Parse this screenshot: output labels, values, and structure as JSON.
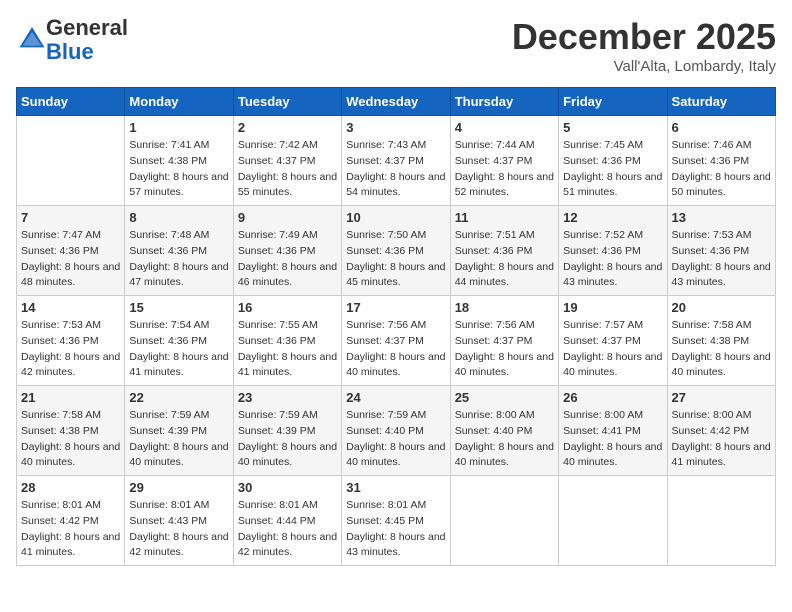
{
  "logo": {
    "general": "General",
    "blue": "Blue"
  },
  "header": {
    "month": "December 2025",
    "location": "Vall'Alta, Lombardy, Italy"
  },
  "weekdays": [
    "Sunday",
    "Monday",
    "Tuesday",
    "Wednesday",
    "Thursday",
    "Friday",
    "Saturday"
  ],
  "weeks": [
    [
      {
        "day": "",
        "sunrise": "",
        "sunset": "",
        "daylight": ""
      },
      {
        "day": "1",
        "sunrise": "Sunrise: 7:41 AM",
        "sunset": "Sunset: 4:38 PM",
        "daylight": "Daylight: 8 hours and 57 minutes."
      },
      {
        "day": "2",
        "sunrise": "Sunrise: 7:42 AM",
        "sunset": "Sunset: 4:37 PM",
        "daylight": "Daylight: 8 hours and 55 minutes."
      },
      {
        "day": "3",
        "sunrise": "Sunrise: 7:43 AM",
        "sunset": "Sunset: 4:37 PM",
        "daylight": "Daylight: 8 hours and 54 minutes."
      },
      {
        "day": "4",
        "sunrise": "Sunrise: 7:44 AM",
        "sunset": "Sunset: 4:37 PM",
        "daylight": "Daylight: 8 hours and 52 minutes."
      },
      {
        "day": "5",
        "sunrise": "Sunrise: 7:45 AM",
        "sunset": "Sunset: 4:36 PM",
        "daylight": "Daylight: 8 hours and 51 minutes."
      },
      {
        "day": "6",
        "sunrise": "Sunrise: 7:46 AM",
        "sunset": "Sunset: 4:36 PM",
        "daylight": "Daylight: 8 hours and 50 minutes."
      }
    ],
    [
      {
        "day": "7",
        "sunrise": "Sunrise: 7:47 AM",
        "sunset": "Sunset: 4:36 PM",
        "daylight": "Daylight: 8 hours and 48 minutes."
      },
      {
        "day": "8",
        "sunrise": "Sunrise: 7:48 AM",
        "sunset": "Sunset: 4:36 PM",
        "daylight": "Daylight: 8 hours and 47 minutes."
      },
      {
        "day": "9",
        "sunrise": "Sunrise: 7:49 AM",
        "sunset": "Sunset: 4:36 PM",
        "daylight": "Daylight: 8 hours and 46 minutes."
      },
      {
        "day": "10",
        "sunrise": "Sunrise: 7:50 AM",
        "sunset": "Sunset: 4:36 PM",
        "daylight": "Daylight: 8 hours and 45 minutes."
      },
      {
        "day": "11",
        "sunrise": "Sunrise: 7:51 AM",
        "sunset": "Sunset: 4:36 PM",
        "daylight": "Daylight: 8 hours and 44 minutes."
      },
      {
        "day": "12",
        "sunrise": "Sunrise: 7:52 AM",
        "sunset": "Sunset: 4:36 PM",
        "daylight": "Daylight: 8 hours and 43 minutes."
      },
      {
        "day": "13",
        "sunrise": "Sunrise: 7:53 AM",
        "sunset": "Sunset: 4:36 PM",
        "daylight": "Daylight: 8 hours and 43 minutes."
      }
    ],
    [
      {
        "day": "14",
        "sunrise": "Sunrise: 7:53 AM",
        "sunset": "Sunset: 4:36 PM",
        "daylight": "Daylight: 8 hours and 42 minutes."
      },
      {
        "day": "15",
        "sunrise": "Sunrise: 7:54 AM",
        "sunset": "Sunset: 4:36 PM",
        "daylight": "Daylight: 8 hours and 41 minutes."
      },
      {
        "day": "16",
        "sunrise": "Sunrise: 7:55 AM",
        "sunset": "Sunset: 4:36 PM",
        "daylight": "Daylight: 8 hours and 41 minutes."
      },
      {
        "day": "17",
        "sunrise": "Sunrise: 7:56 AM",
        "sunset": "Sunset: 4:37 PM",
        "daylight": "Daylight: 8 hours and 40 minutes."
      },
      {
        "day": "18",
        "sunrise": "Sunrise: 7:56 AM",
        "sunset": "Sunset: 4:37 PM",
        "daylight": "Daylight: 8 hours and 40 minutes."
      },
      {
        "day": "19",
        "sunrise": "Sunrise: 7:57 AM",
        "sunset": "Sunset: 4:37 PM",
        "daylight": "Daylight: 8 hours and 40 minutes."
      },
      {
        "day": "20",
        "sunrise": "Sunrise: 7:58 AM",
        "sunset": "Sunset: 4:38 PM",
        "daylight": "Daylight: 8 hours and 40 minutes."
      }
    ],
    [
      {
        "day": "21",
        "sunrise": "Sunrise: 7:58 AM",
        "sunset": "Sunset: 4:38 PM",
        "daylight": "Daylight: 8 hours and 40 minutes."
      },
      {
        "day": "22",
        "sunrise": "Sunrise: 7:59 AM",
        "sunset": "Sunset: 4:39 PM",
        "daylight": "Daylight: 8 hours and 40 minutes."
      },
      {
        "day": "23",
        "sunrise": "Sunrise: 7:59 AM",
        "sunset": "Sunset: 4:39 PM",
        "daylight": "Daylight: 8 hours and 40 minutes."
      },
      {
        "day": "24",
        "sunrise": "Sunrise: 7:59 AM",
        "sunset": "Sunset: 4:40 PM",
        "daylight": "Daylight: 8 hours and 40 minutes."
      },
      {
        "day": "25",
        "sunrise": "Sunrise: 8:00 AM",
        "sunset": "Sunset: 4:40 PM",
        "daylight": "Daylight: 8 hours and 40 minutes."
      },
      {
        "day": "26",
        "sunrise": "Sunrise: 8:00 AM",
        "sunset": "Sunset: 4:41 PM",
        "daylight": "Daylight: 8 hours and 40 minutes."
      },
      {
        "day": "27",
        "sunrise": "Sunrise: 8:00 AM",
        "sunset": "Sunset: 4:42 PM",
        "daylight": "Daylight: 8 hours and 41 minutes."
      }
    ],
    [
      {
        "day": "28",
        "sunrise": "Sunrise: 8:01 AM",
        "sunset": "Sunset: 4:42 PM",
        "daylight": "Daylight: 8 hours and 41 minutes."
      },
      {
        "day": "29",
        "sunrise": "Sunrise: 8:01 AM",
        "sunset": "Sunset: 4:43 PM",
        "daylight": "Daylight: 8 hours and 42 minutes."
      },
      {
        "day": "30",
        "sunrise": "Sunrise: 8:01 AM",
        "sunset": "Sunset: 4:44 PM",
        "daylight": "Daylight: 8 hours and 42 minutes."
      },
      {
        "day": "31",
        "sunrise": "Sunrise: 8:01 AM",
        "sunset": "Sunset: 4:45 PM",
        "daylight": "Daylight: 8 hours and 43 minutes."
      },
      {
        "day": "",
        "sunrise": "",
        "sunset": "",
        "daylight": ""
      },
      {
        "day": "",
        "sunrise": "",
        "sunset": "",
        "daylight": ""
      },
      {
        "day": "",
        "sunrise": "",
        "sunset": "",
        "daylight": ""
      }
    ]
  ]
}
